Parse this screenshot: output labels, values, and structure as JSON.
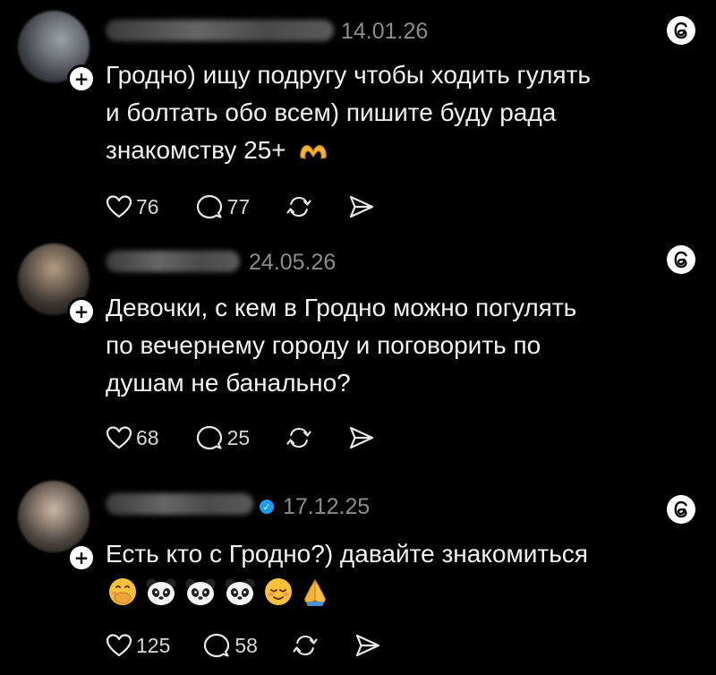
{
  "posts": [
    {
      "date": "14.01.26",
      "verified": false,
      "lines": [
        "Гродно) ищу подругу чтобы ходить гулять",
        "и болтать обо всем) пишите буду рада"
      ],
      "last_line": "знакомству 25+",
      "emojis": [
        "heart-hands"
      ],
      "likes": "76",
      "replies": "77"
    },
    {
      "date": "24.05.26",
      "verified": false,
      "lines": [
        "Девочки, с кем в Гродно можно погулять",
        "по вечернему городу и поговорить по",
        "душам не банально?"
      ],
      "likes": "68",
      "replies": "25"
    },
    {
      "date": "17.12.25",
      "verified": true,
      "lines": [
        "Есть кто с Гродно?) давайте знакомиться"
      ],
      "emojis": [
        "face-with-hand-over-mouth",
        "panda-face",
        "panda-face",
        "panda-face",
        "relieved-face",
        "folded-hands"
      ],
      "likes": "125",
      "replies": "58"
    }
  ],
  "colors": {
    "background": "#000000",
    "text": "#f2f2f2",
    "muted": "#8c8c8c",
    "verified": "#1d9bf0"
  },
  "icons": [
    "heart-icon",
    "comment-icon",
    "repost-icon",
    "share-icon",
    "threads-logo-icon",
    "follow-plus-icon"
  ]
}
